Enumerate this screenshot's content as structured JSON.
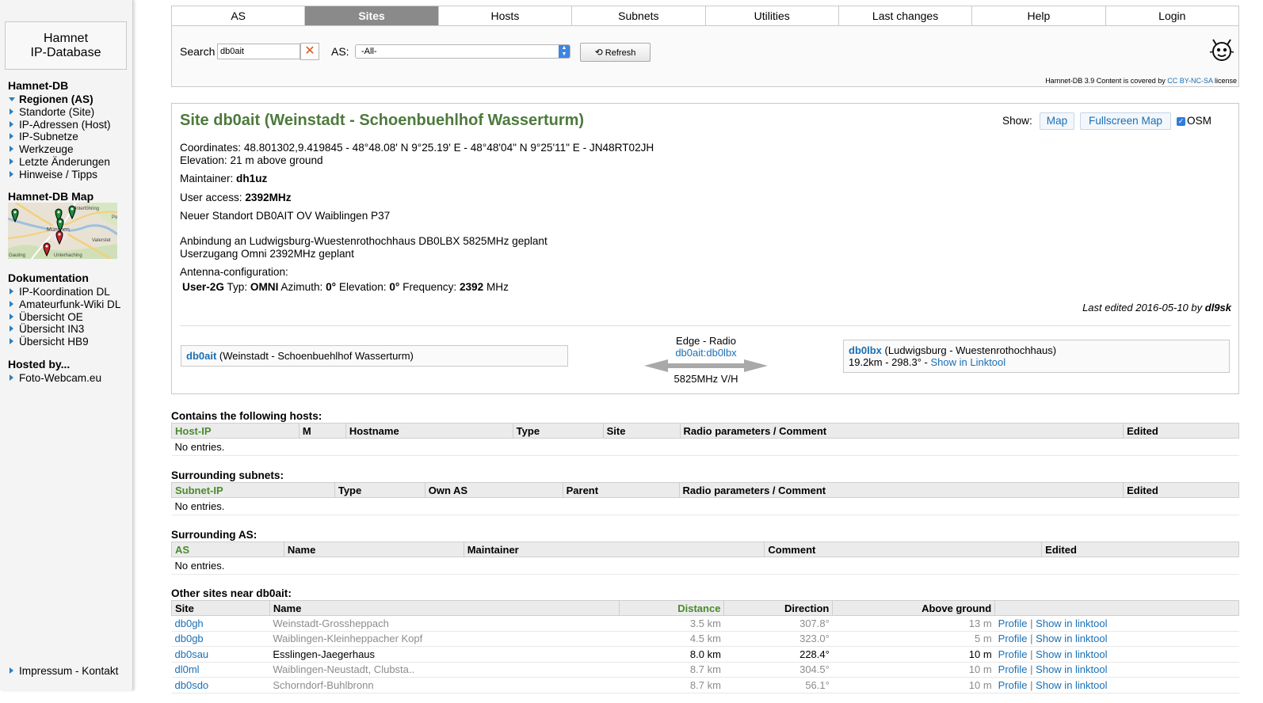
{
  "sidebar": {
    "logo_line1": "Hamnet",
    "logo_line2": "IP-Database",
    "heading_db": "Hamnet-DB",
    "db_items": [
      {
        "label": "Regionen (AS)"
      },
      {
        "label": "Standorte (Site)"
      },
      {
        "label": "IP-Adressen (Host)"
      },
      {
        "label": "IP-Subnetze"
      },
      {
        "label": "Werkzeuge"
      },
      {
        "label": "Letzte Änderungen"
      },
      {
        "label": "Hinweise / Tipps"
      }
    ],
    "heading_map": "Hamnet-DB Map",
    "map_labels": [
      "Unterföhring",
      "München",
      "Vaterstet",
      "Gauting",
      "Unterhaching",
      "Po"
    ],
    "heading_docs": "Dokumentation",
    "doc_items": [
      {
        "label": "IP-Koordination DL"
      },
      {
        "label": "Amateurfunk-Wiki DL"
      },
      {
        "label": "Übersicht OE"
      },
      {
        "label": "Übersicht IN3"
      },
      {
        "label": "Übersicht HB9"
      }
    ],
    "heading_hosted": "Hosted by...",
    "hosted_items": [
      {
        "label": "Foto-Webcam.eu"
      }
    ],
    "footer_link": "Impressum - Kontakt"
  },
  "nav": {
    "tabs": [
      {
        "label": "AS"
      },
      {
        "label": "Sites"
      },
      {
        "label": "Hosts"
      },
      {
        "label": "Subnets"
      },
      {
        "label": "Utilities"
      },
      {
        "label": "Last changes"
      },
      {
        "label": "Help"
      },
      {
        "label": "Login"
      }
    ],
    "active": "Sites"
  },
  "search": {
    "label": "Search",
    "value": "db0ait",
    "clear_glyph": "✕",
    "as_label": "AS:",
    "as_value": "-All-",
    "refresh_label": "Refresh"
  },
  "license": {
    "prefix": "Hamnet-DB 3.9 Content is covered by",
    "link": "CC BY-NC-SA",
    "suffix": "license"
  },
  "site": {
    "title": "Site db0ait (Weinstadt - Schoenbuehlhof Wasserturm)",
    "show_label": "Show:",
    "btn_map": "Map",
    "btn_fullscreen": "Fullscreen Map",
    "osm_label": "OSM",
    "coordinates": "Coordinates: 48.801302,9.419845  -  48°48.08' N 9°25.19' E  -  48°48'04\" N 9°25'11\" E  -  JN48RT02JH",
    "elevation": "Elevation: 21 m above ground",
    "maintainer_label": "Maintainer:",
    "maintainer": "dh1uz",
    "user_access_label": "User access:",
    "user_access": "2392MHz",
    "comment1": "Neuer Standort DB0AIT OV Waiblingen P37",
    "comment2": "Anbindung an Ludwigsburg-Wuestenrothochhaus DB0LBX 5825MHz geplant",
    "comment3": "Userzugang Omni 2392MHz geplant",
    "antenna_label": "Antenna-configuration:",
    "antenna": {
      "name": "User-2G",
      "type_label": "Typ:",
      "type": "OMNI",
      "azimuth_label": "Azimuth:",
      "azimuth": "0°",
      "elevation_label": "Elevation:",
      "elevation": "0°",
      "freq_label": "Frequency:",
      "freq": "2392",
      "freq_unit": "MHz"
    },
    "last_edited_prefix": "Last edited 2016-05-10 by",
    "last_edited_by": "dl9sk",
    "link": {
      "left_call": "db0ait",
      "left_name": "(Weinstadt - Schoenbuehlhof Wasserturm)",
      "type": "Edge - Radio",
      "name": "db0ait:db0lbx",
      "freq": "5825MHz V/H",
      "right_call": "db0lbx",
      "right_name": "(Ludwigsburg - Wuestenrothochhaus)",
      "right_dist": "19.2km - 298.3° -",
      "right_link": "Show in Linktool"
    }
  },
  "hosts": {
    "title": "Contains the following hosts:",
    "columns": [
      "Host-IP",
      "M",
      "Hostname",
      "Type",
      "Site",
      "Radio parameters / Comment",
      "Edited"
    ],
    "empty": "No entries."
  },
  "subnets": {
    "title": "Surrounding subnets:",
    "columns": [
      "Subnet-IP",
      "Type",
      "Own AS",
      "Parent",
      "Radio parameters / Comment",
      "Edited"
    ],
    "empty": "No entries."
  },
  "as_table": {
    "title": "Surrounding AS:",
    "columns": [
      "AS",
      "Name",
      "Maintainer",
      "Comment",
      "Edited"
    ],
    "empty": "No entries."
  },
  "nearby": {
    "title": "Other sites near db0ait:",
    "columns": [
      "Site",
      "Name",
      "Distance",
      "Direction",
      "Above ground",
      ""
    ],
    "profile_label": "Profile",
    "sep": "|",
    "linktool_label": "Show in linktool",
    "rows": [
      {
        "site": "db0gh",
        "name": "Weinstadt-Grossheppach",
        "distance": "3.5 km",
        "direction": "307.8°",
        "above": "13 m",
        "dim": true
      },
      {
        "site": "db0gb",
        "name": "Waiblingen-Kleinheppacher Kopf",
        "distance": "4.5 km",
        "direction": "323.0°",
        "above": "5 m",
        "dim": true
      },
      {
        "site": "db0sau",
        "name": "Esslingen-Jaegerhaus",
        "distance": "8.0 km",
        "direction": "228.4°",
        "above": "10 m",
        "dim": false
      },
      {
        "site": "dl0ml",
        "name": "Waiblingen-Neustadt, Clubsta..",
        "distance": "8.7 km",
        "direction": "304.5°",
        "above": "10 m",
        "dim": true
      },
      {
        "site": "db0sdo",
        "name": "Schorndorf-Buhlbronn",
        "distance": "8.7 km",
        "direction": "56.1°",
        "above": "10 m",
        "dim": true
      }
    ]
  },
  "colors": {
    "title_green": "#4d7a3c",
    "link_blue": "#1a6fb5",
    "active_tab": "#8a8a8a"
  }
}
